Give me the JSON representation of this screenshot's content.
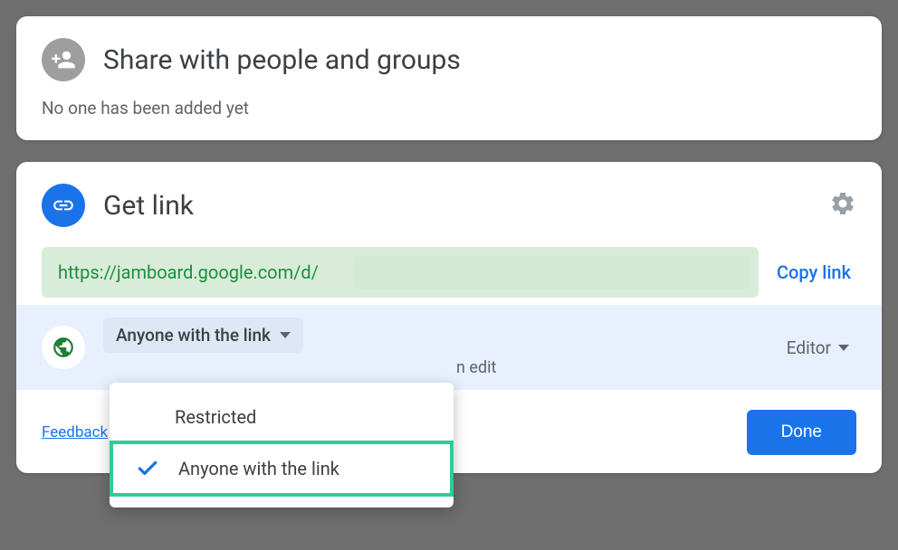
{
  "share": {
    "title": "Share with people and groups",
    "subtitle": "No one has been added yet"
  },
  "getlink": {
    "title": "Get link",
    "url": "https://jamboard.google.com/d/",
    "copy_label": "Copy link"
  },
  "access": {
    "selected_label": "Anyone with the link",
    "description": "n edit",
    "role_label": "Editor",
    "options": {
      "restricted": "Restricted",
      "anyone": "Anyone with the link"
    }
  },
  "footer": {
    "feedback": "Feedback",
    "done": "Done"
  }
}
